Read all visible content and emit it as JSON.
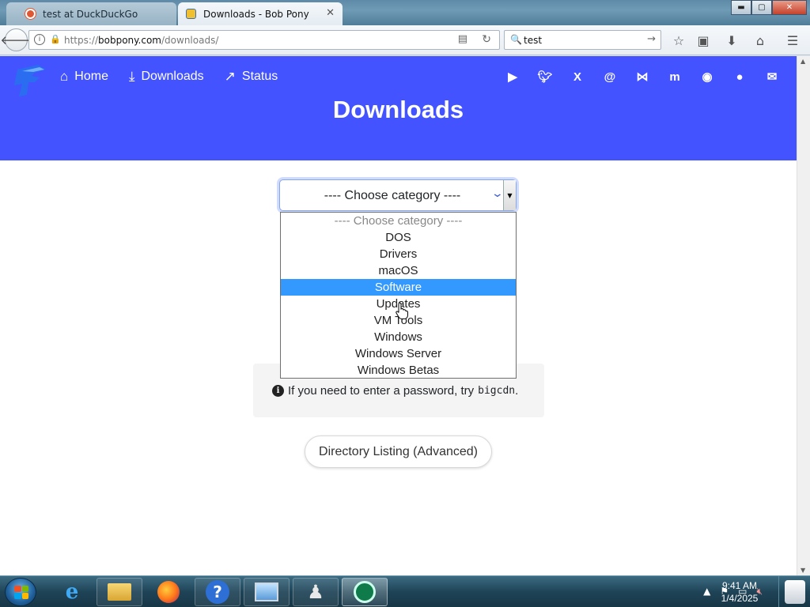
{
  "tabs": [
    {
      "label": "test at DuckDuckGo",
      "active": false
    },
    {
      "label": "Downloads - Bob Pony",
      "active": true
    }
  ],
  "window_controls": {
    "minimize": "▬",
    "maximize": "▢",
    "close": "✕"
  },
  "navbar": {
    "url_domain": "bobpony.com",
    "url_prefix": "https://",
    "url_path": "/downloads/",
    "search_value": "test"
  },
  "site": {
    "nav": [
      {
        "label": "Home",
        "icon": "home-icon"
      },
      {
        "label": "Downloads",
        "icon": "download-icon"
      },
      {
        "label": "Status",
        "icon": "trending-up-icon"
      }
    ],
    "socials": [
      "youtube-icon",
      "twitter-icon",
      "x-icon",
      "threads-icon",
      "bluesky-icon",
      "mastodon-icon",
      "discord-icon",
      "github-icon",
      "email-icon"
    ],
    "page_title": "Downloads",
    "accent": "#4353ff"
  },
  "category_select": {
    "current": "---- Choose category ----",
    "options": [
      "---- Choose category ----",
      "DOS",
      "Drivers",
      "macOS",
      "Software",
      "Updates",
      "VM Tools",
      "Windows",
      "Windows Server",
      "Windows Betas"
    ],
    "highlighted": "Software"
  },
  "info": {
    "prefix": "If you need to enter a password, try",
    "password": "bigcdn",
    "suffix": "."
  },
  "directory_button": "Directory Listing (Advanced)",
  "taskbar": {
    "apps": [
      "internet-explorer-icon",
      "file-explorer-icon",
      "firefox-icon",
      "help-icon",
      "remote-desktop-icon",
      "chess-icon",
      "app-icon"
    ],
    "time": "9:41 AM",
    "date": "1/4/2025"
  }
}
